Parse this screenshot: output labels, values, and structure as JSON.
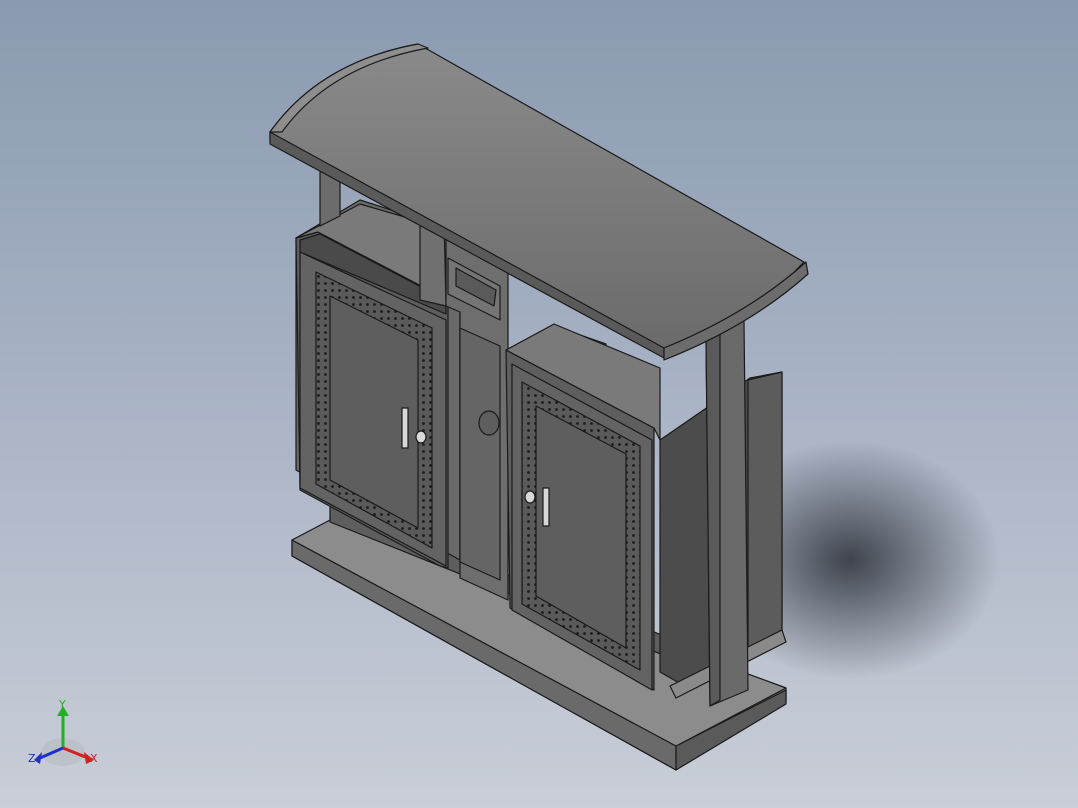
{
  "viewport": {
    "background_top": "#8a9ab0",
    "background_bottom": "#c9ced8",
    "model": "double-compartment-waste-bin",
    "colors": {
      "body": "#6e6e6e",
      "body_dark": "#545454",
      "body_light": "#838383",
      "roof": "#7a7a7a",
      "edge": "#1a1a1a"
    }
  },
  "triad": {
    "x_label": "X",
    "y_label": "Y",
    "z_label": "Z",
    "x_color": "#d02020",
    "y_color": "#20b020",
    "z_color": "#2030c0"
  }
}
